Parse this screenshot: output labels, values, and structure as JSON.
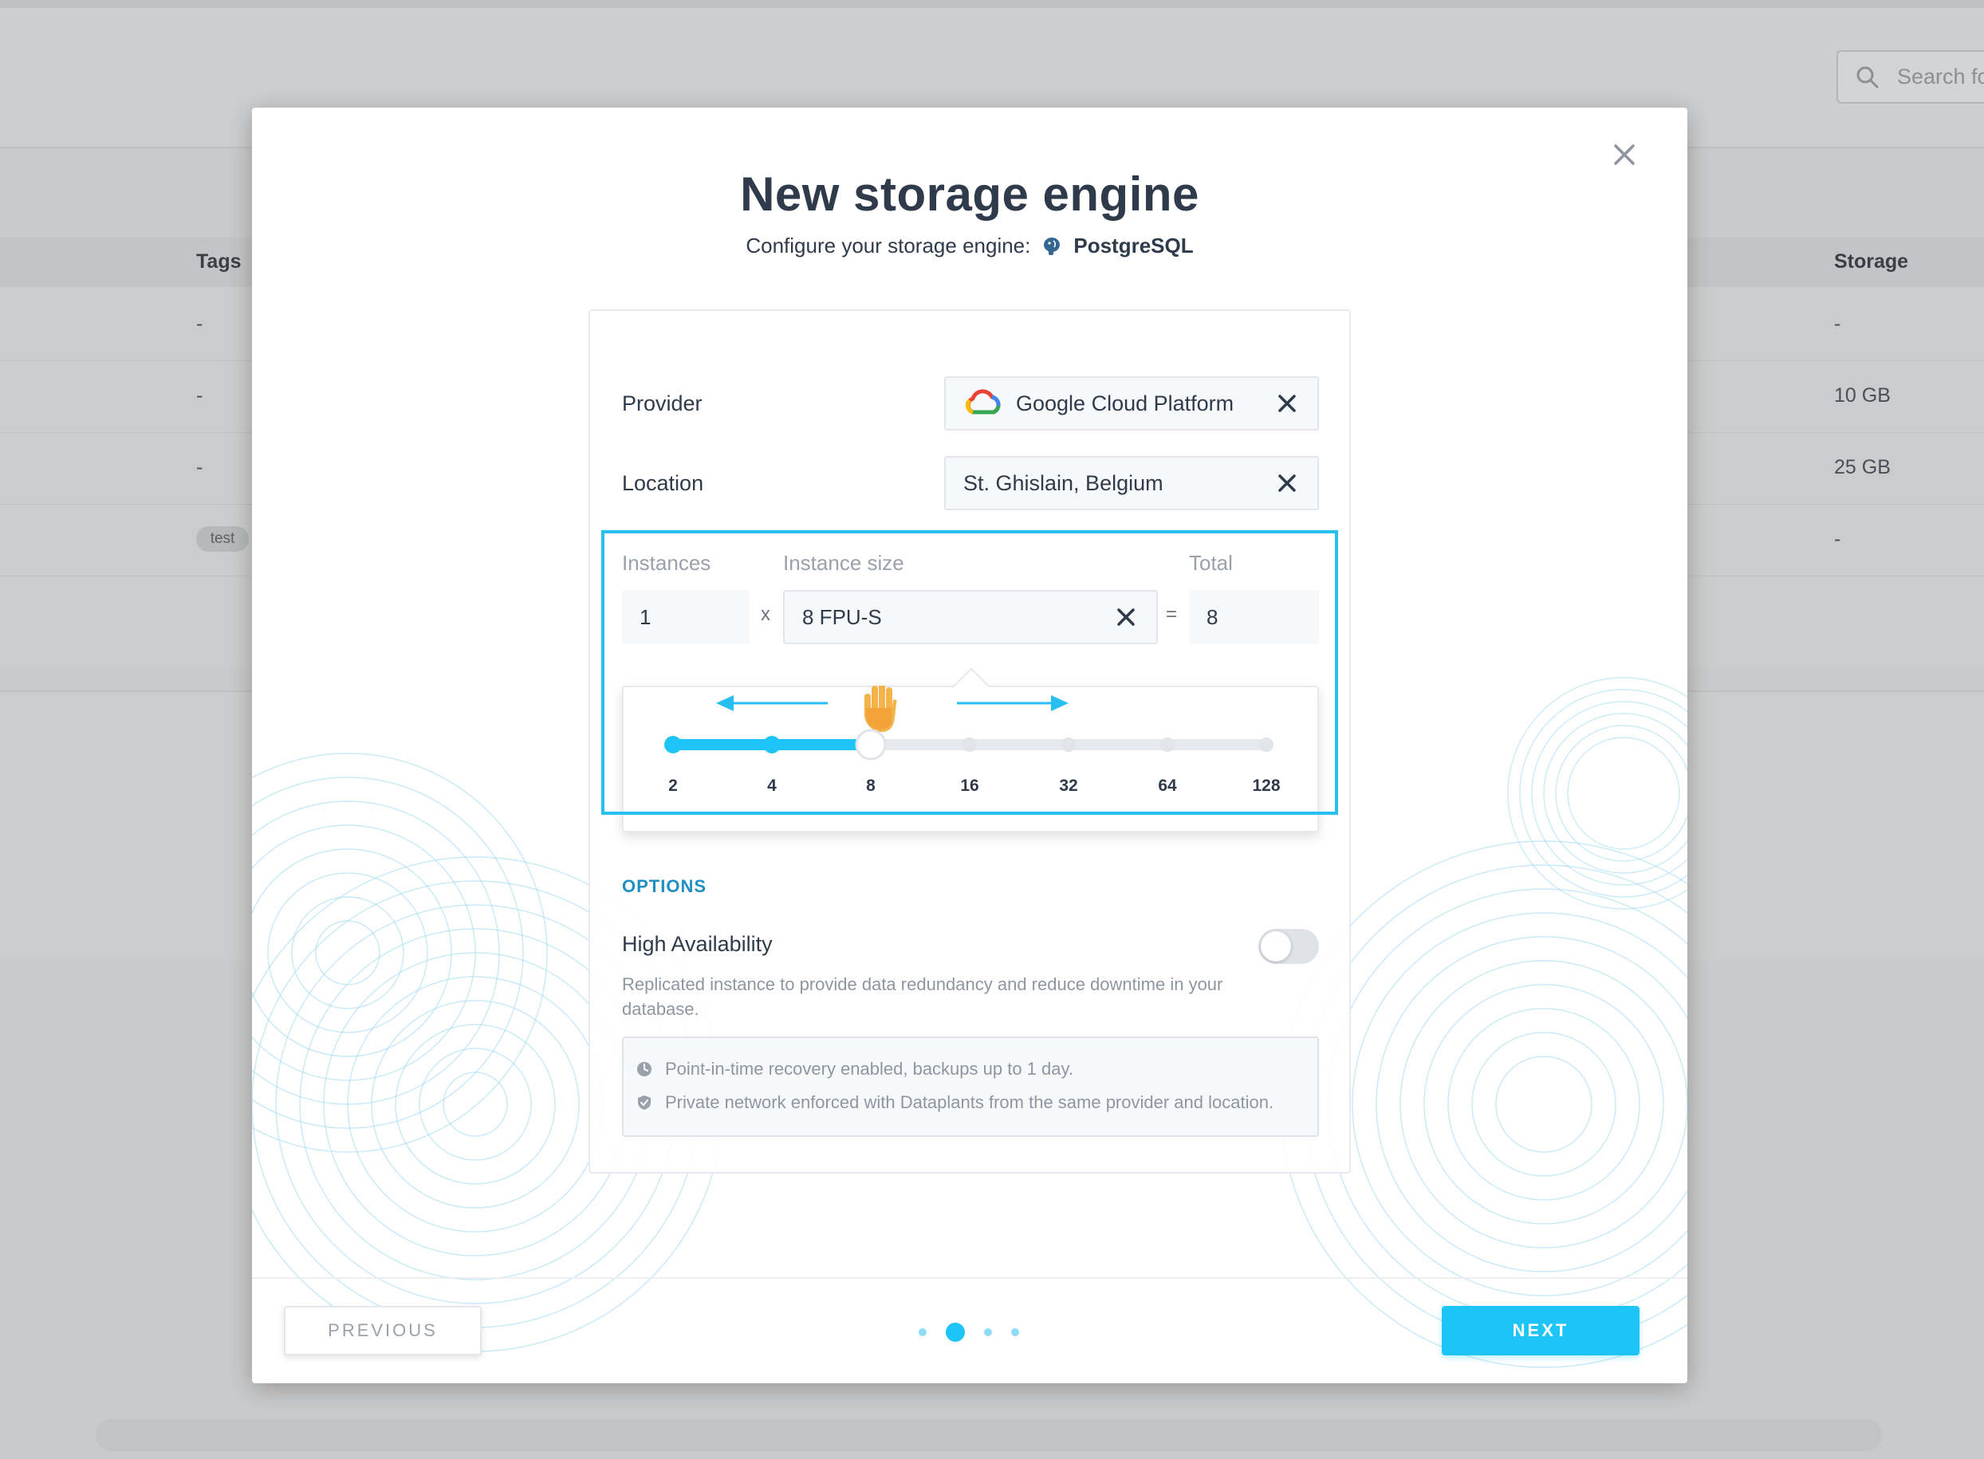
{
  "background": {
    "search_placeholder": "Search fo",
    "table": {
      "headers": {
        "tags": "Tags",
        "storage": "Storage"
      },
      "rows": [
        {
          "tags": "-",
          "storage": "-"
        },
        {
          "tags": "-",
          "storage": "10 GB"
        },
        {
          "tags": "-",
          "storage": "25 GB"
        },
        {
          "tags": "test",
          "storage": "-"
        }
      ]
    }
  },
  "modal": {
    "title": "New storage engine",
    "subtitle": "Configure your storage engine:",
    "engine_name": "PostgreSQL",
    "provider": {
      "label": "Provider",
      "value": "Google Cloud Platform"
    },
    "location": {
      "label": "Location",
      "value": "St. Ghislain, Belgium"
    },
    "sizing": {
      "instances_label": "Instances",
      "instance_size_label": "Instance size",
      "total_label": "Total",
      "instances_value": "1",
      "multiply_sign": "x",
      "instance_size_value": "8 FPU-S",
      "equals_sign": "=",
      "total_value": "8",
      "slider": {
        "ticks": [
          "2",
          "4",
          "8",
          "16",
          "32",
          "64",
          "128"
        ],
        "selected_index": 2
      }
    },
    "options": {
      "title": "OPTIONS",
      "high_availability": {
        "label": "High Availability",
        "enabled": false,
        "description": "Replicated instance to provide data redundancy and reduce downtime in your database."
      },
      "info": [
        "Point-in-time recovery enabled, backups up to 1 day.",
        "Private network enforced with Dataplants from the same provider and location."
      ]
    },
    "footer": {
      "previous_label": "PREVIOUS",
      "next_label": "NEXT",
      "steps_total": 4,
      "current_step": 2
    }
  },
  "colors": {
    "accent": "#1ec4f5",
    "highlight": "#27bff0",
    "options_title": "#1f8fc4",
    "text": "#2f3a4a",
    "muted": "#8e96a1"
  },
  "icons": {
    "search": "search-icon",
    "close": "close-icon",
    "engine": "postgresql-elephant-icon",
    "provider": "google-cloud-icon",
    "clear": "clear-x-icon",
    "drag_hint": "hand-icon",
    "clock": "clock-icon",
    "shield": "shield-icon"
  }
}
